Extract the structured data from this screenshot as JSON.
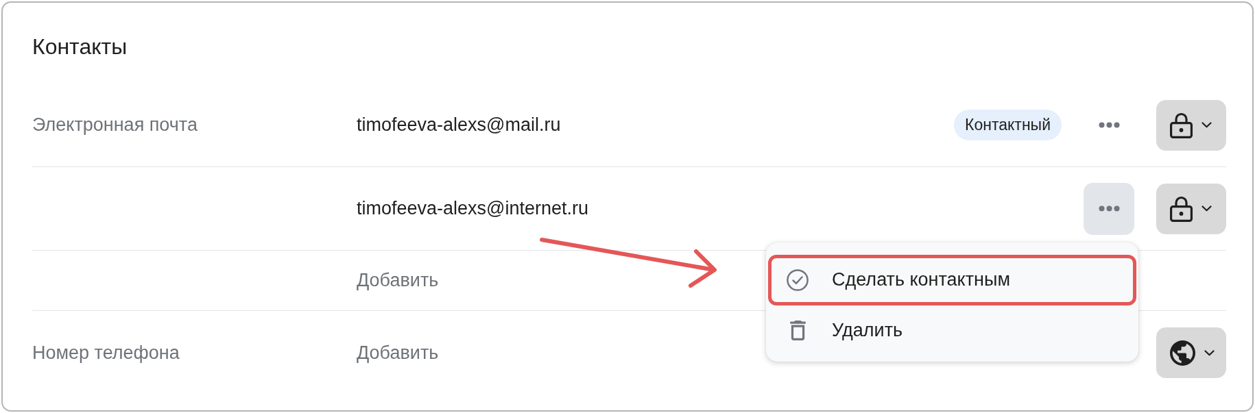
{
  "title": "Контакты",
  "rows": [
    {
      "kind": "entry",
      "label": "Электронная почта",
      "value": "timofeeva-alexs@mail.ru",
      "badge": "Контактный",
      "menu_open": false,
      "access": {
        "kind": "private"
      }
    },
    {
      "kind": "entry",
      "value": "timofeeva-alexs@internet.ru",
      "menu_open": true,
      "access": {
        "kind": "private"
      }
    },
    {
      "kind": "add",
      "value": "Добавить"
    },
    {
      "kind": "add",
      "label": "Номер телефона",
      "value": "Добавить",
      "access": {
        "kind": "public"
      }
    }
  ],
  "menu": {
    "items": [
      {
        "kind": "make_contact",
        "label": "Сделать контактным",
        "highlighted": true
      },
      {
        "kind": "delete",
        "label": "Удалить",
        "highlighted": false
      }
    ]
  }
}
